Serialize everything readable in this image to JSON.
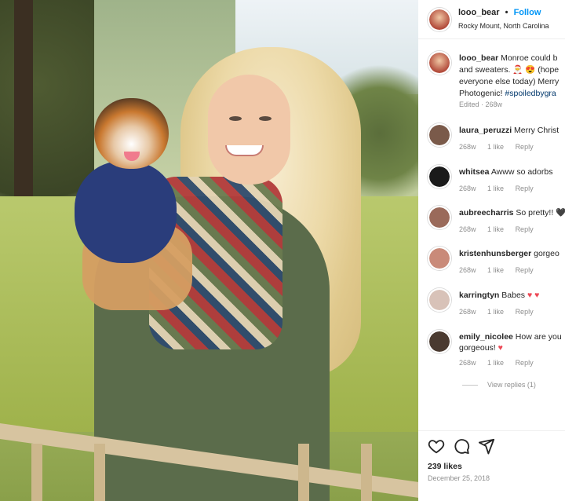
{
  "header": {
    "username": "looo_bear",
    "separator": "•",
    "follow_label": "Follow",
    "location": "Rocky Mount, North Carolina"
  },
  "caption": {
    "username": "looo_bear",
    "text_1": " Monroe could b",
    "text_2": "and sweaters. 🎅 😍 (hope",
    "text_3": "everyone else today) Merry",
    "text_4": "Photogenic! ",
    "hashtag": "#spoiledbygra",
    "edited": "Edited · 268w"
  },
  "comments": [
    {
      "user": "laura_peruzzi",
      "text": " Merry Christ",
      "time": "268w",
      "likes": "1 like",
      "reply": "Reply",
      "avatar_color": "#7a5a4a"
    },
    {
      "user": "whitsea",
      "text": " Awww so adorbs",
      "time": "268w",
      "likes": "1 like",
      "reply": "Reply",
      "avatar_color": "#1a1a1a"
    },
    {
      "user": "aubreecharris",
      "text": " So pretty!! 🖤",
      "time": "268w",
      "likes": "1 like",
      "reply": "Reply",
      "avatar_color": "#9a6a5a"
    },
    {
      "user": "kristenhunsberger",
      "text": " gorgeo",
      "time": "268w",
      "likes": "1 like",
      "reply": "Reply",
      "avatar_color": "#c98a79"
    },
    {
      "user": "karringtyn",
      "text": " Babes",
      "time": "268w",
      "likes": "1 like",
      "reply": "Reply",
      "avatar_color": "#d8c2b8"
    },
    {
      "user": "emily_nicolee",
      "text": " How are you",
      "text_2": "gorgeous! ",
      "time": "268w",
      "likes": "1 like",
      "reply": "Reply",
      "avatar_color": "#4a3a30"
    }
  ],
  "view_replies": "View replies (1)",
  "likes": "239 likes",
  "date": "December 25, 2018",
  "icons": {
    "like": "heart-icon",
    "comment": "comment-icon",
    "share": "share-icon"
  },
  "colors": {
    "follow": "#0095f6",
    "hashtag": "#00376b",
    "heart": "#ed4956",
    "muted": "#8e8e8e"
  }
}
